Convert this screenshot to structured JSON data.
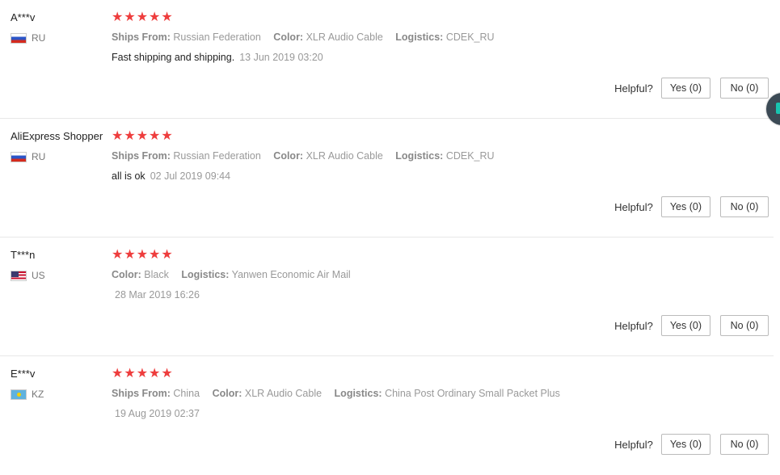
{
  "helpful_label": "Helpful?",
  "reviews": [
    {
      "user": "A***v",
      "country": "RU",
      "flag": "ru-flag",
      "stars": "★★★★★",
      "attributes": [
        {
          "label": "Ships From:",
          "value": "Russian Federation"
        },
        {
          "label": "Color:",
          "value": "XLR Audio Cable"
        },
        {
          "label": "Logistics:",
          "value": "CDEK_RU"
        }
      ],
      "text": "Fast shipping and shipping.",
      "date": "13 Jun 2019 03:20",
      "yes": "Yes (0)",
      "no": "No (0)"
    },
    {
      "user": "AliExpress Shopper",
      "country": "RU",
      "flag": "ru-flag",
      "stars": "★★★★★",
      "attributes": [
        {
          "label": "Ships From:",
          "value": "Russian Federation"
        },
        {
          "label": "Color:",
          "value": "XLR Audio Cable"
        },
        {
          "label": "Logistics:",
          "value": "CDEK_RU"
        }
      ],
      "text": "all is ok",
      "date": "02 Jul 2019 09:44",
      "yes": "Yes (0)",
      "no": "No (0)"
    },
    {
      "user": "T***n",
      "country": "US",
      "flag": "us-flag",
      "stars": "★★★★★",
      "attributes": [
        {
          "label": "Color:",
          "value": "Black"
        },
        {
          "label": "Logistics:",
          "value": "Yanwen Economic Air Mail"
        }
      ],
      "text": "",
      "date": "28 Mar 2019 16:26",
      "yes": "Yes (0)",
      "no": "No (0)"
    },
    {
      "user": "E***v",
      "country": "KZ",
      "flag": "kz-flag",
      "stars": "★★★★★",
      "attributes": [
        {
          "label": "Ships From:",
          "value": "China"
        },
        {
          "label": "Color:",
          "value": "XLR Audio Cable"
        },
        {
          "label": "Logistics:",
          "value": "China Post Ordinary Small Packet Plus"
        }
      ],
      "text": "",
      "date": "19 Aug 2019 02:37",
      "yes": "Yes (0)",
      "no": "No (0)"
    }
  ],
  "colors": {
    "star": "#ee3d3d",
    "muted_text": "#999999",
    "border": "#e8e8e8"
  }
}
